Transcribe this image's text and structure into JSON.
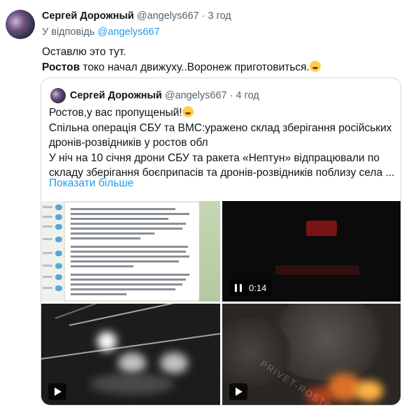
{
  "tweet": {
    "author_name": "Сергей Дорожный",
    "author_handle": "@angelys667",
    "separator": "·",
    "time": "3 год",
    "replying_prefix": "У відповідь",
    "replying_handle": "@angelys667",
    "line1": "Оставлю это тут.",
    "line2_bold": "Ростов",
    "line2_rest": " токо начал движуху..Воронеж приготовиться."
  },
  "quote": {
    "author_name": "Сергей Дорожный",
    "author_handle": "@angelys667",
    "separator": "·",
    "time": "4 год",
    "lines": [
      "Ростов,у вас пропущеный!",
      "Спільна операція СБУ та ВМС:уражено склад зберігання російських",
      "дронів-розвідників у ростов обл",
      "У ніч на 10 січня дрони СБУ та ракета «Нептун» відпрацювали по",
      "складу зберігання боєприпасів та дронів-розвідників поблизу села ..."
    ],
    "show_more": "Показати більше"
  },
  "media": {
    "video1_time": "0:14"
  },
  "icons": {
    "emoji_laugh": "rolling-on-floor-laughing-emoji",
    "emoji_tears": "face-with-tears-of-joy-emoji",
    "pause": "pause-icon",
    "play": "play-icon"
  },
  "colors": {
    "link": "#1d9bf0",
    "secondary_text": "#536471",
    "border": "#cfd9de"
  }
}
